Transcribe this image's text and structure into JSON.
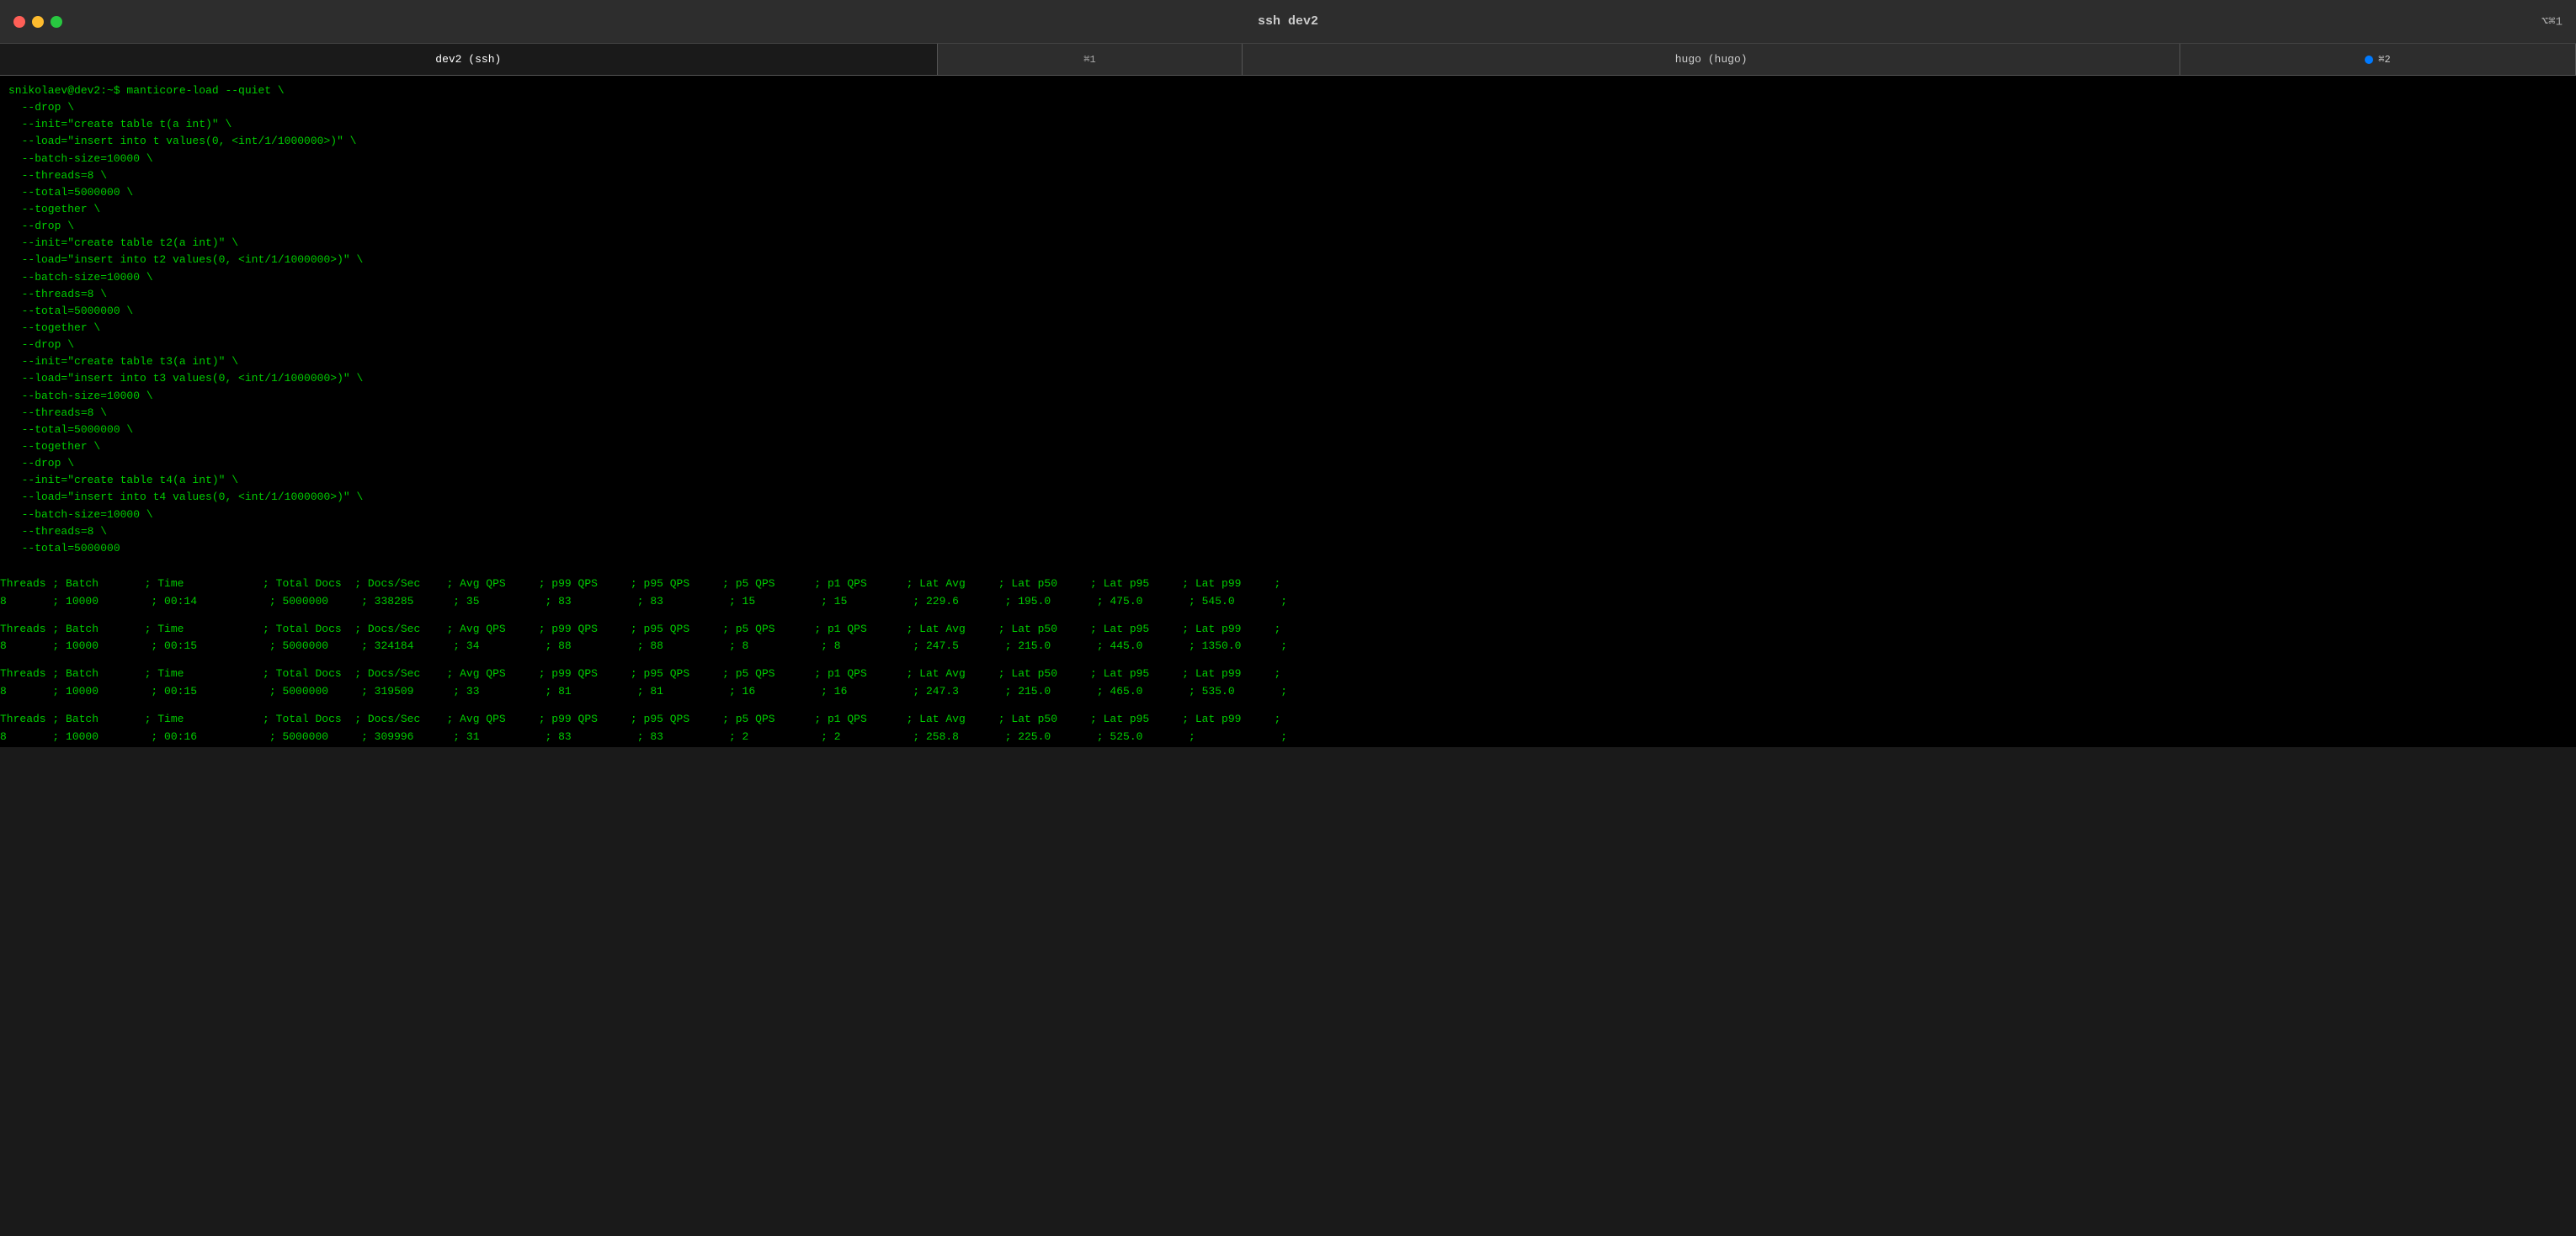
{
  "titlebar": {
    "title": "ssh dev2",
    "shortcut_right": "⌥⌘1",
    "tab2_label": "⌘2"
  },
  "tabs": [
    {
      "label": "dev2 (ssh)",
      "active": true,
      "shortcut": "⌘1"
    },
    {
      "label": "hugo (hugo)",
      "active": false,
      "shortcut": ""
    },
    {
      "label": "⌘2",
      "active": false,
      "shortcut": "⌘2"
    }
  ],
  "command_lines": [
    "snikolaev@dev2:~$ manticore-load --quiet \\",
    "  --drop \\",
    "  --init=\"create table t(a int)\" \\",
    "  --load=\"insert into t values(0, <int/1/1000000>)\" \\",
    "  --batch-size=10000 \\",
    "  --threads=8 \\",
    "  --total=5000000 \\",
    "  --together \\",
    "  --drop \\",
    "  --init=\"create table t2(a int)\" \\",
    "  --load=\"insert into t2 values(0, <int/1/1000000>)\" \\",
    "  --batch-size=10000 \\",
    "  --threads=8 \\",
    "  --total=5000000 \\",
    "  --together \\",
    "  --drop \\",
    "  --init=\"create table t3(a int)\" \\",
    "  --load=\"insert into t3 values(0, <int/1/1000000>)\" \\",
    "  --batch-size=10000 \\",
    "  --threads=8 \\",
    "  --total=5000000 \\",
    "  --together \\",
    "  --drop \\",
    "  --init=\"create table t4(a int)\" \\",
    "  --load=\"insert into t4 values(0, <int/1/1000000>)\" \\",
    "  --batch-size=10000 \\",
    "  --threads=8 \\",
    "  --total=5000000"
  ],
  "table_sections": [
    {
      "header": "Threads ; Batch       ; Time            ; Total Docs  ; Docs/Sec    ; Avg QPS     ; p99 QPS     ; p95 QPS     ; p5 QPS      ; p1 QPS      ; Lat Avg     ; Lat p50     ; Lat p95     ; Lat p99     ;",
      "data": "8       ; 10000        ; 00:14           ; 5000000     ; 338285      ; 35          ; 83          ; 83          ; 15          ; 15          ; 229.6       ; 195.0       ; 475.0       ; 545.0       ;"
    },
    {
      "header": "Threads ; Batch       ; Time            ; Total Docs  ; Docs/Sec    ; Avg QPS     ; p99 QPS     ; p95 QPS     ; p5 QPS      ; p1 QPS      ; Lat Avg     ; Lat p50     ; Lat p95     ; Lat p99     ;",
      "data": "8       ; 10000        ; 00:15           ; 5000000     ; 324184      ; 34          ; 88          ; 88          ; 8           ; 8           ; 247.5       ; 215.0       ; 445.0       ; 1350.0      ;"
    },
    {
      "header": "Threads ; Batch       ; Time            ; Total Docs  ; Docs/Sec    ; Avg QPS     ; p99 QPS     ; p95 QPS     ; p5 QPS      ; p1 QPS      ; Lat Avg     ; Lat p50     ; Lat p95     ; Lat p99     ;",
      "data": "8       ; 10000        ; 00:15           ; 5000000     ; 319509      ; 33          ; 81          ; 81          ; 16          ; 16          ; 247.3       ; 215.0       ; 465.0       ; 535.0       ;"
    },
    {
      "header": "Threads ; Batch       ; Time            ; Total Docs  ; Docs/Sec    ; Avg QPS     ; p99 QPS     ; p95 QPS     ; p5 QPS      ; p1 QPS      ; Lat Avg     ; Lat p50     ; Lat p95     ; Lat p99     ;",
      "data": "8       ; 10000        ; 00:16           ; 5000000     ; 309996      ; 31          ; 83          ; 83          ; 2           ; 2           ; 258.8       ; 225.0       ; 525.0       ;             ;"
    }
  ]
}
